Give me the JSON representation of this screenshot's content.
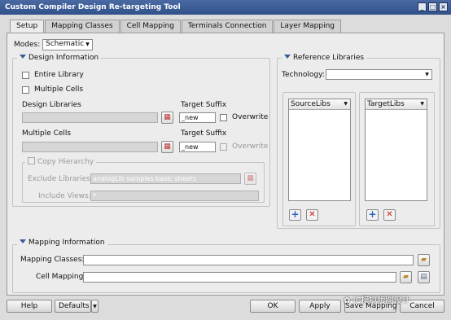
{
  "window": {
    "title": "Custom Compiler Design Re-targeting Tool"
  },
  "tabs": [
    "Setup",
    "Mapping Classes",
    "Cell Mapping",
    "Terminals Connection",
    "Layer Mapping"
  ],
  "modes": {
    "label": "Modes:",
    "value": "Schematic"
  },
  "design_info": {
    "title": "Design Information",
    "entire_library": "Entire Library",
    "multiple_cells": "Multiple Cells",
    "design_libraries": "Design Libraries",
    "target_suffix": "Target Suffix",
    "suffix_value": "_new",
    "overwrite": "Overwrite",
    "multiple_cells_label": "Multiple Cells",
    "target_suffix2": "Target Suffix",
    "suffix_value2": "_new",
    "overwrite2": "Overwrite",
    "copy_hierarchy": "Copy Hierarchy",
    "exclude_libraries": "Exclude Libraries:",
    "exclude_value": "analogLib samples basic sheets",
    "include_views": "Include Views:",
    "include_value": "*"
  },
  "reference_libraries": {
    "title": "Reference Libraries",
    "technology": "Technology:",
    "source_libs": "SourceLibs",
    "target_libs": "TargetLibs"
  },
  "mapping_info": {
    "title": "Mapping Information",
    "mapping_classes": "Mapping Classes:",
    "cell_mapping": "Cell Mapping:"
  },
  "footer": {
    "help": "Help",
    "defaults": "Defaults",
    "ok": "OK",
    "apply": "Apply",
    "save_mapping": "Save Mapping",
    "cancel": "Cancel"
  },
  "watermark": "IC模拟版图设计"
}
